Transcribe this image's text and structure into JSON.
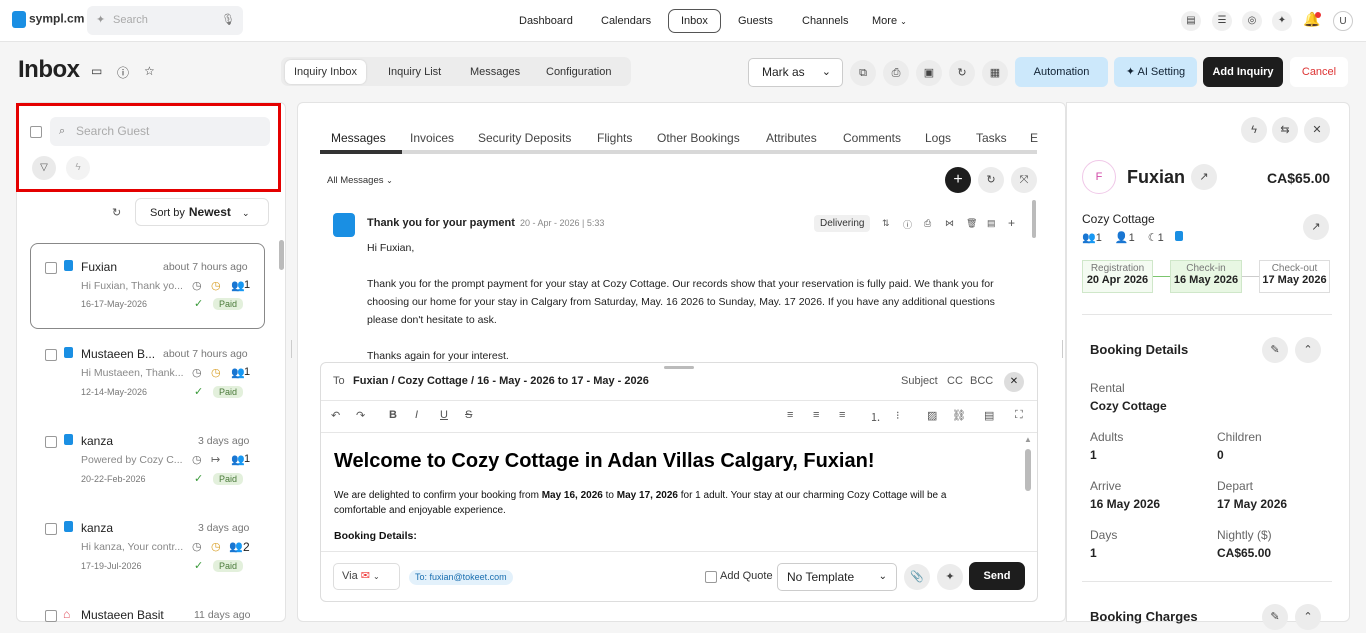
{
  "topbar": {
    "brand": "sympl.cm",
    "search_placeholder": "Search",
    "nav": [
      "Dashboard",
      "Calendars",
      "Inbox",
      "Guests",
      "Channels",
      "More"
    ],
    "user_initial": "U"
  },
  "header": {
    "title": "Inbox",
    "tabs": [
      "Inquiry Inbox",
      "Inquiry List",
      "Messages",
      "Configuration"
    ],
    "mark_as": "Mark as",
    "automation": "Automation",
    "ai_setting": "AI Setting",
    "add_inquiry": "Add Inquiry",
    "cancel": "Cancel"
  },
  "left": {
    "search_placeholder": "Search Guest",
    "sort_label": "Sort by",
    "sort_value": "Newest",
    "conversations": [
      {
        "name": "Fuxian",
        "time": "about 7 hours ago",
        "preview": "Hi Fuxian, Thank yo...",
        "dates": "16-17-May-2026",
        "guests": "1",
        "status": "Paid"
      },
      {
        "name": "Mustaeen B...",
        "time": "about 7 hours ago",
        "preview": "Hi Mustaeen, Thank...",
        "dates": "12-14-May-2026",
        "guests": "1",
        "status": "Paid"
      },
      {
        "name": "kanza",
        "time": "3 days ago",
        "preview": "Powered by Cozy C...",
        "dates": "20-22-Feb-2026",
        "guests": "1",
        "status": "Paid"
      },
      {
        "name": "kanza",
        "time": "3 days ago",
        "preview": "Hi kanza, Your contr...",
        "dates": "17-19-Jul-2026",
        "guests": "2",
        "status": "Paid"
      },
      {
        "name": "Mustaeen Basit",
        "time": "11 days ago"
      }
    ]
  },
  "middle": {
    "tabs": [
      "Messages",
      "Invoices",
      "Security Deposits",
      "Flights",
      "Other Bookings",
      "Attributes",
      "Comments",
      "Logs",
      "Tasks",
      "E"
    ],
    "filter": "All Messages",
    "message": {
      "subject": "Thank you for your payment",
      "timestamp": "20 - Apr - 2026 | 5:33",
      "status": "Delivering",
      "greeting": "Hi Fuxian,",
      "line1": "Thank you for the prompt payment for your stay at Cozy Cottage. Our records show that your reservation is fully paid. We thank you for",
      "line2": "choosing our home for your stay in Calgary from Saturday, May. 16 2026 to Sunday, May. 17 2026. If you have any additional questions",
      "line3": "please don't hesitate to ask.",
      "closing": "Thanks again for your interest."
    },
    "compose": {
      "to_label": "To",
      "to_value": "Fuxian / Cozy Cottage / 16 - May - 2026 to 17 - May - 2026",
      "subject": "Subject",
      "cc": "CC",
      "bcc": "BCC",
      "heading": "Welcome to Cozy Cottage in Adan Villas Calgary, Fuxian!",
      "p1a": "We are delighted to confirm your booking from ",
      "p1b": "May 16, 2026",
      "p1c": " to ",
      "p1d": "May 17, 2026",
      "p1e": " for 1 adult. Your stay at our charming Cozy Cottage will be a",
      "p2": "comfortable and enjoyable experience.",
      "booking_details": "Booking Details:",
      "via": "Via",
      "to_email": "To: fuxian@tokeet.com",
      "add_quote": "Add Quote",
      "template": "No Template",
      "send": "Send"
    }
  },
  "right": {
    "initial": "F",
    "name": "Fuxian",
    "amount": "CA$65.00",
    "rental": "Cozy Cottage",
    "counts": [
      "1",
      "1",
      "1"
    ],
    "registration_label": "Registration",
    "registration": "20 Apr 2026",
    "checkin_label": "Check-in",
    "checkin": "16 May 2026",
    "checkout_label": "Check-out",
    "checkout": "17 May 2026",
    "booking_details_title": "Booking Details",
    "rental_label": "Rental",
    "rental_value": "Cozy Cottage",
    "adults_label": "Adults",
    "adults": "1",
    "children_label": "Children",
    "children": "0",
    "arrive_label": "Arrive",
    "arrive": "16 May 2026",
    "depart_label": "Depart",
    "depart": "17 May 2026",
    "days_label": "Days",
    "days": "1",
    "nightly_label": "Nightly ($)",
    "nightly": "CA$65.00",
    "booking_charges_title": "Booking Charges"
  },
  "colors": {
    "accent_blue": "#1a8fe3",
    "highlight_red": "#e40000",
    "ai_blue": "#cce8fb"
  }
}
